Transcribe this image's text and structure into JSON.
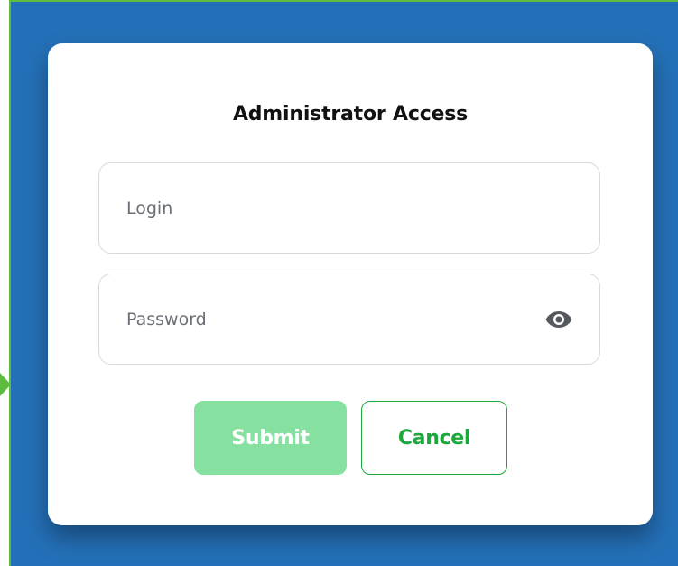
{
  "dialog": {
    "title": "Administrator Access",
    "login_field": {
      "placeholder": "Login",
      "value": ""
    },
    "password_field": {
      "placeholder": "Password",
      "value": "",
      "toggle_icon": "eye-icon"
    },
    "buttons": {
      "submit_label": "Submit",
      "cancel_label": "Cancel"
    }
  },
  "colors": {
    "backdrop": "#2470b8",
    "backdrop_border": "#5dbb3d",
    "submit_bg": "#86e0a0",
    "cancel_accent": "#1ca83c"
  }
}
